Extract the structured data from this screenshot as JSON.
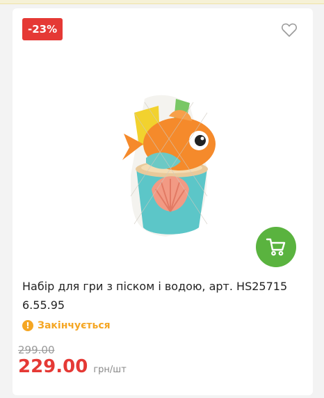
{
  "product": {
    "discount_badge": "-23%",
    "title": "Набір для гри з піском і водою, арт. HS25715 6.55.95",
    "stock_status": "Закінчується",
    "warning_icon_glyph": "!",
    "old_price": "299.00",
    "new_price": "229.00",
    "price_unit": "грн/шт"
  },
  "icons": {
    "wishlist": "heart-outline-icon",
    "cart": "shopping-cart-icon",
    "stock": "warning-icon"
  },
  "colors": {
    "badge": "#e53935",
    "cart_button": "#5ab33f",
    "price": "#e53935",
    "stock_warning": "#f5a623"
  }
}
